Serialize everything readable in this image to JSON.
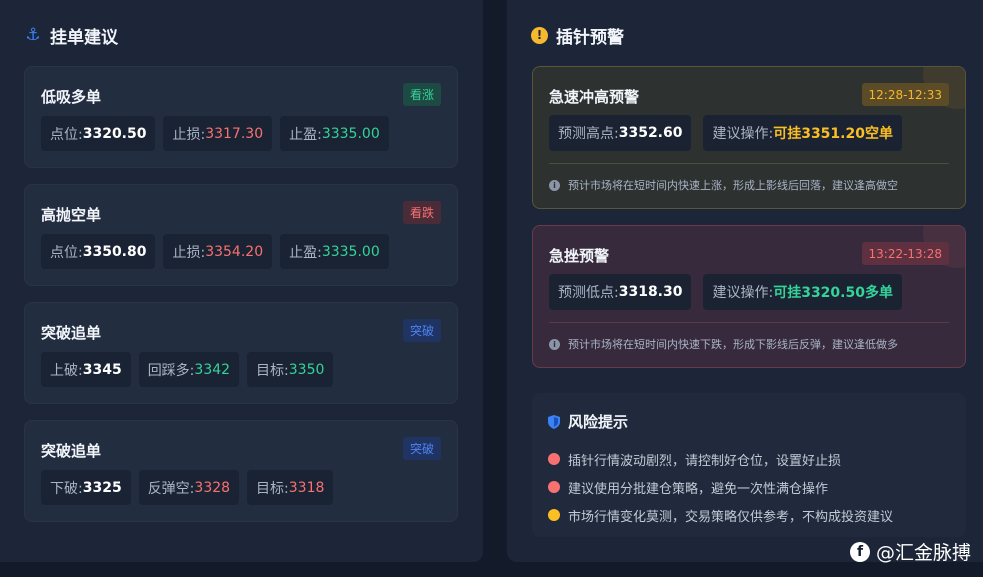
{
  "left_panel": {
    "title": "挂单建议",
    "icon": "anchor-icon",
    "cards": [
      {
        "name": "低吸多单",
        "badge": "看涨",
        "badge_type": "up",
        "items": [
          {
            "label": "点位: ",
            "value": "3320.50",
            "tone": "white"
          },
          {
            "label": "止损: ",
            "value": "3317.30",
            "tone": "red"
          },
          {
            "label": "止盈: ",
            "value": "3335.00",
            "tone": "green"
          }
        ]
      },
      {
        "name": "高抛空单",
        "badge": "看跌",
        "badge_type": "down",
        "items": [
          {
            "label": "点位: ",
            "value": "3350.80",
            "tone": "white"
          },
          {
            "label": "止损: ",
            "value": "3354.20",
            "tone": "red"
          },
          {
            "label": "止盈: ",
            "value": "3335.00",
            "tone": "green"
          }
        ]
      },
      {
        "name": "突破追单",
        "badge": "突破",
        "badge_type": "break",
        "items": [
          {
            "label": "上破: ",
            "value": "3345",
            "tone": "white"
          },
          {
            "label": "回踩多: ",
            "value": "3342",
            "tone": "green"
          },
          {
            "label": "目标: ",
            "value": "3350",
            "tone": "green"
          }
        ]
      },
      {
        "name": "突破追单",
        "badge": "突破",
        "badge_type": "break",
        "items": [
          {
            "label": "下破: ",
            "value": "3325",
            "tone": "white"
          },
          {
            "label": "反弹空: ",
            "value": "3328",
            "tone": "red"
          },
          {
            "label": "目标: ",
            "value": "3318",
            "tone": "red"
          }
        ]
      }
    ]
  },
  "right_panel": {
    "title": "插针预警",
    "icon": "alert-icon",
    "alerts": [
      {
        "name": "急速冲高预警",
        "time": "12:28-12:33",
        "point_label": "预测高点: ",
        "point_value": "3352.60",
        "action_label": "建议操作: ",
        "action_value": "可挂3351.20空单",
        "note": "预计市场将在短时间内快速上涨，形成上影线后回落，建议逢高做空"
      },
      {
        "name": "急挫预警",
        "time": "13:22-13:28",
        "point_label": "预测低点: ",
        "point_value": "3318.30",
        "action_label": "建议操作: ",
        "action_value": "可挂3320.50多单",
        "note": "预计市场将在短时间内快速下跌，形成下影线后反弹，建议逢低做多"
      }
    ],
    "risk": {
      "title": "风险提示",
      "icon": "shield-icon",
      "items": [
        {
          "text": "插针行情波动剧烈，请控制好仓位，设置好止损",
          "color": "#f87171"
        },
        {
          "text": "建议使用分批建仓策略，避免一次性满仓操作",
          "color": "#f87171"
        },
        {
          "text": "市场行情变化莫测，交易策略仅供参考，不构成投资建议",
          "color": "#fbbf24"
        }
      ]
    }
  },
  "watermark": {
    "text": "@汇金脉搏",
    "icon": "weibo-logo-icon"
  }
}
